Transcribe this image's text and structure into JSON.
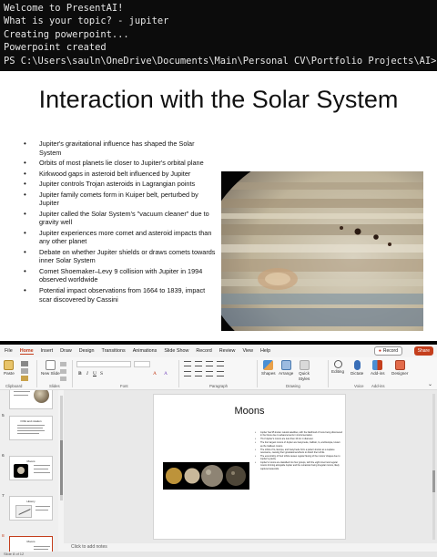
{
  "terminal": {
    "lines": [
      "Welcome to PresentAI!",
      "What is your topic? - jupiter",
      "Creating powerpoint...",
      "Powerpoint created",
      "PS C:\\Users\\sauln\\OneDrive\\Documents\\Main\\Personal CV\\Portfolio Projects\\AI>"
    ]
  },
  "slide1": {
    "title": "Interaction with the Solar System",
    "bullets": [
      "Jupiter's gravitational influence has shaped the Solar System",
      "Orbits of most planets lie closer to Jupiter's orbital plane",
      "Kirkwood gaps in asteroid belt influenced by Jupiter",
      "Jupiter controls Trojan asteroids in Lagrangian points",
      "Jupiter family comets form in Kuiper belt, perturbed by Jupiter",
      "Jupiter called the Solar System's \"vacuum cleaner\" due to gravity well",
      "Jupiter experiences more comet and asteroid impacts than any other planet",
      "Debate on whether Jupiter shields or draws comets towards inner Solar System",
      "Comet Shoemaker–Levy 9 collision with Jupiter in 1994 observed worldwide",
      "Potential impact observations from 1664 to 1839, impact scar discovered by Cassini"
    ]
  },
  "ppt": {
    "menu": [
      "File",
      "Home",
      "Insert",
      "Draw",
      "Design",
      "Transitions",
      "Animations",
      "Slide Show",
      "Record",
      "Review",
      "View",
      "Help"
    ],
    "active_menu": "Home",
    "record_label": "Record",
    "share_label": "Share",
    "ribbon": {
      "paste": "Paste",
      "new_slide": "New Slide",
      "groups": [
        "Clipboard",
        "Slides",
        "Font",
        "Paragraph",
        "Drawing",
        "Voice",
        "Add-ins"
      ],
      "shapes": "Shapes",
      "arrange": "Arrange",
      "quick_styles": "Quick Styles",
      "editing": "Editing",
      "dictate": "Dictate",
      "add_ins": "Add-ins",
      "designer": "Designer"
    },
    "thumbnails": [
      {
        "number": "",
        "title": ""
      },
      {
        "number": "5",
        "title": "Orbit and rotation"
      },
      {
        "number": "6",
        "title": "Moons"
      },
      {
        "number": "7",
        "title": "History"
      },
      {
        "number": "8",
        "title": "Moons"
      }
    ],
    "slide": {
      "title": "Moons",
      "bullets": [
        "Jupiter has 95 known natural satellites, with the likelihood of more being discovered in the future due to advancements in instrumentation.",
        "79 of Jupiter's moons are less than 10 km in diameter.",
        "The four largest moons of Jupiter are Ganymede, Callisto, Io, and Europa, known as the Galilean moons.",
        "The orbits of Io, Europa, and Ganymede form a pattern known as a Laplace resonance, causing their gravitational effects to distort their orbits.",
        "The eccentricity of their orbits causes regular flexing of the moons' shapes due to Jupiter's gravity.",
        "Jupiter's moons are classified into four groups, with the eight innermost regular moons forming alongside Jupiter and the remainder being irregular moons, likely captured asteroids."
      ]
    },
    "notes_placeholder": "Click to add notes",
    "status": "Slide 8 of 12"
  }
}
